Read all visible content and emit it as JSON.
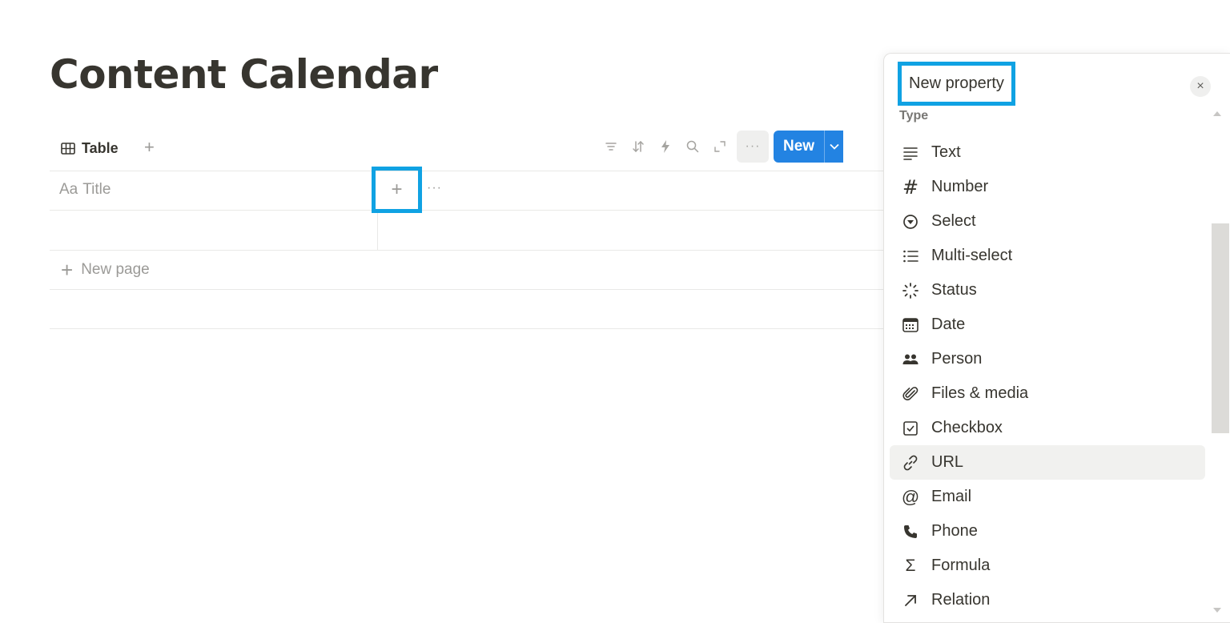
{
  "page": {
    "title": "Content Calendar"
  },
  "view": {
    "tab_label": "Table",
    "add_view": "+"
  },
  "toolbar": {
    "new_label": "New",
    "more": "···"
  },
  "table": {
    "title_column": "Title",
    "title_column_prefix": "Aa",
    "add_property": "+",
    "column_more": "···",
    "new_page_label": "New page",
    "new_page_plus": "+"
  },
  "panel": {
    "title": "New property",
    "close": "×",
    "type_label": "Type",
    "types": [
      {
        "label": "Text",
        "icon": "text-lines-icon"
      },
      {
        "label": "Number",
        "icon": "hash-icon"
      },
      {
        "label": "Select",
        "icon": "select-circle-icon"
      },
      {
        "label": "Multi-select",
        "icon": "list-icon"
      },
      {
        "label": "Status",
        "icon": "status-spinner-icon"
      },
      {
        "label": "Date",
        "icon": "calendar-icon"
      },
      {
        "label": "Person",
        "icon": "people-icon"
      },
      {
        "label": "Files & media",
        "icon": "paperclip-icon"
      },
      {
        "label": "Checkbox",
        "icon": "checkbox-icon"
      },
      {
        "label": "URL",
        "icon": "link-icon"
      },
      {
        "label": "Email",
        "icon": "at-icon"
      },
      {
        "label": "Phone",
        "icon": "phone-icon"
      },
      {
        "label": "Formula",
        "icon": "sigma-icon"
      },
      {
        "label": "Relation",
        "icon": "arrow-up-right-icon"
      }
    ],
    "hovered_type": "URL"
  },
  "colors": {
    "accent": "#2383e2",
    "highlight_box": "#10a2e3",
    "text": "#37352f",
    "muted": "#9b9a97"
  }
}
